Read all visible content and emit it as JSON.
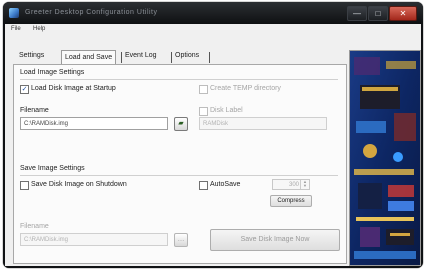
{
  "window": {
    "title": "Greeter Desktop Configuration Utility",
    "min_symbol": "—",
    "max_symbol": "□",
    "close_symbol": "✕"
  },
  "menu": [
    "File",
    "Help"
  ],
  "tabs": [
    {
      "label": "Settings",
      "active": false
    },
    {
      "label": "Load and Save",
      "active": true
    },
    {
      "label": "Event Log",
      "active": false
    },
    {
      "label": "Options",
      "active": false
    }
  ],
  "load_section": {
    "title": "Load Image Settings",
    "load_on_startup_label": "Load Disk Image at Startup",
    "load_on_startup_checked": true,
    "create_temp_label": "Create TEMP directory",
    "filename_label": "Filename",
    "filename_value": "C:\\RAMDisk.img",
    "disk_label_check": "Disk Label",
    "disk_label_value": "RAMDisk"
  },
  "save_section": {
    "title": "Save Image Settings",
    "save_on_shutdown_label": "Save Disk Image on Shutdown",
    "save_on_shutdown_checked": false,
    "autosave_label": "AutoSave",
    "autosave_interval": "300",
    "compress_label": "Compress",
    "filename_label": "Filename",
    "filename_value": "C:\\RAMDisk.img",
    "save_now_button": "Save Disk Image Now"
  },
  "icons": {
    "browse_active": "folder-icon",
    "browse_disabled": "ellipsis-icon"
  }
}
